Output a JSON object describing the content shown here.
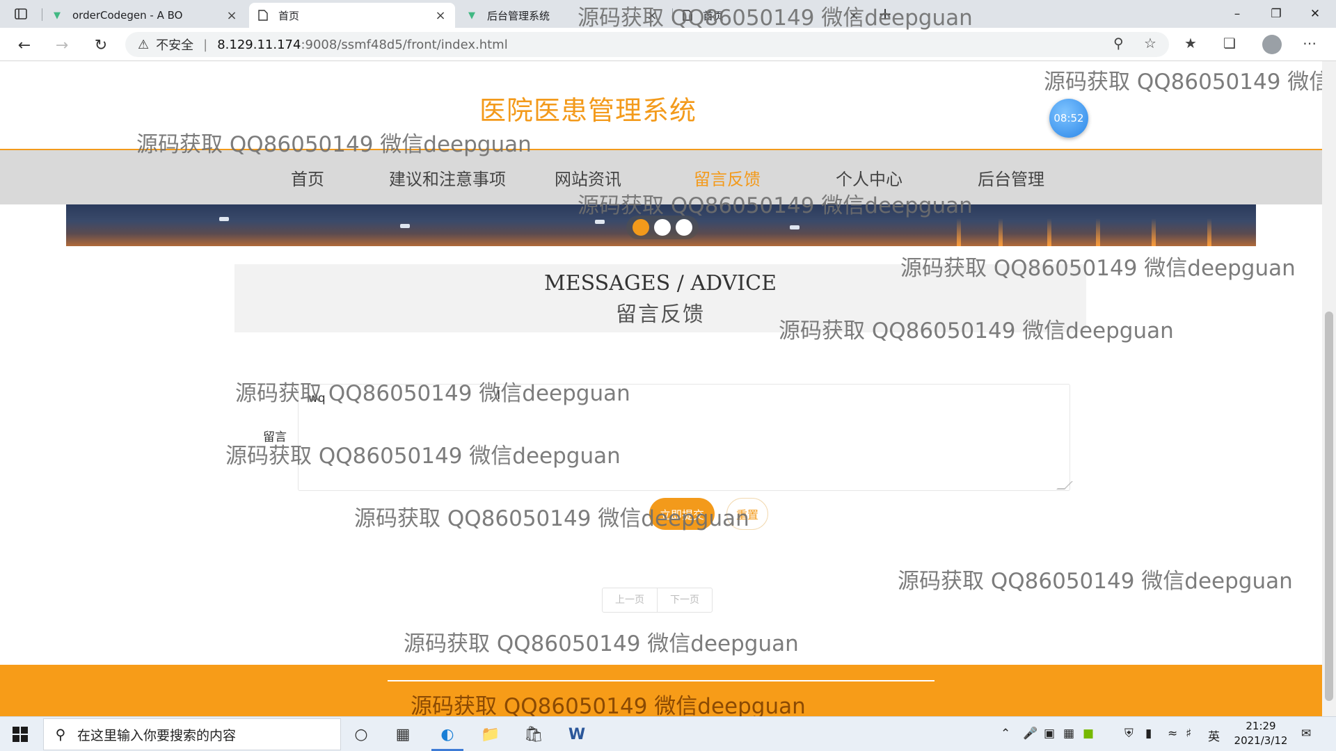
{
  "browser": {
    "tabs": [
      {
        "label": "orderCodegen - A BO",
        "icon": "vue-icon",
        "active": false
      },
      {
        "label": "首页",
        "icon": "page-icon",
        "active": true
      },
      {
        "label": "后台管理系统",
        "icon": "vue-icon",
        "active": false
      }
    ],
    "address": {
      "security_label": "不安全",
      "host": "8.129.11.174",
      "path": ":9008/ssmf48d5/front/index.html"
    }
  },
  "site": {
    "title": "医院医患管理系统",
    "clock": "08:52",
    "nav": [
      {
        "label": "首页",
        "active": false
      },
      {
        "label": "建议和注意事项",
        "active": false
      },
      {
        "label": "网站资讯",
        "active": false
      },
      {
        "label": "留言反馈",
        "active": true
      },
      {
        "label": "个人中心",
        "active": false
      },
      {
        "label": "后台管理",
        "active": false
      }
    ],
    "carousel": {
      "slides": 3,
      "active_index": 0
    }
  },
  "section": {
    "title_en": "MESSAGES / ADVICE",
    "title_cn": "留言反馈"
  },
  "form": {
    "message_label": "留言",
    "message_value": "wq",
    "submit_label": "立即提交",
    "reset_label": "重置"
  },
  "pager": {
    "prev_label": "上一页",
    "next_label": "下一页"
  },
  "watermark": {
    "text": "源码获取 QQ86050149 微信deepguan",
    "partial_text": "源码获取 QQ86050149 微信de"
  },
  "taskbar": {
    "search_placeholder": "在这里输入你要搜索的内容",
    "ime_label": "英",
    "time": "21:29",
    "date": "2021/3/12"
  },
  "colors": {
    "accent": "#f39a1b",
    "footer": "#f79c18",
    "nav_bg": "#d9d9d9"
  }
}
